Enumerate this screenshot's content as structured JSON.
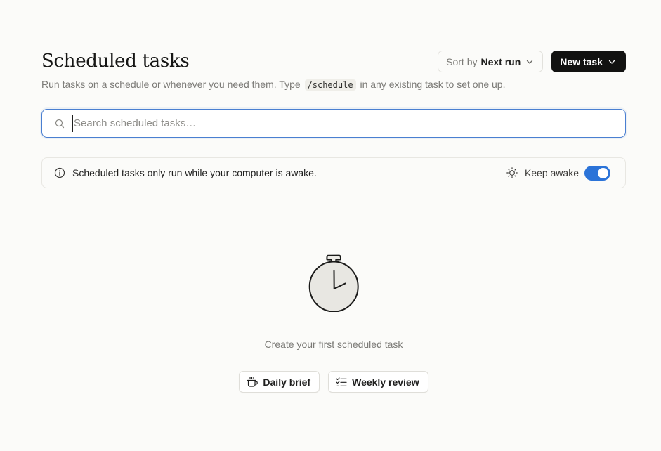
{
  "header": {
    "title": "Scheduled tasks",
    "subtitle_before": "Run tasks on a schedule or whenever you need them. Type",
    "subtitle_code": "/schedule",
    "subtitle_after": "in any existing task to set one up.",
    "sort": {
      "prefix": "Sort by",
      "value": "Next run",
      "icon": "chevron-down-icon"
    },
    "new_task": {
      "label": "New task",
      "icon": "chevron-down-icon"
    }
  },
  "search": {
    "placeholder": "Search scheduled tasks…",
    "value": "",
    "icon": "search-icon"
  },
  "notice": {
    "icon": "info-icon",
    "text": "Scheduled tasks only run while your computer is awake.",
    "keep_awake": {
      "icon": "sun-icon",
      "label": "Keep awake",
      "enabled": true
    }
  },
  "empty_state": {
    "illustration": "stopwatch-icon",
    "message": "Create your first scheduled task",
    "templates": [
      {
        "label": "Daily brief",
        "icon": "coffee-cup-icon"
      },
      {
        "label": "Weekly review",
        "icon": "checklist-icon"
      }
    ]
  },
  "colors": {
    "background": "#fbfbf9",
    "accent": "#2b73d8",
    "primary_button": "#121211",
    "focus_border": "#4a7fd1"
  }
}
